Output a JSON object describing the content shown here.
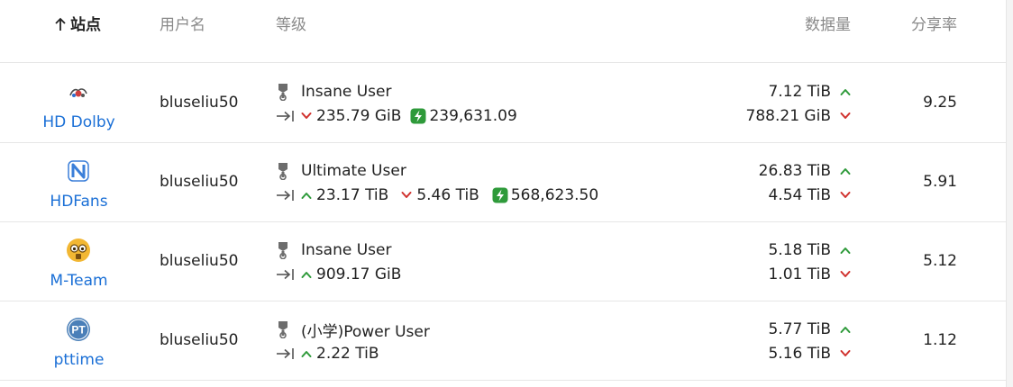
{
  "columns": {
    "site": "站点",
    "username": "用户名",
    "level": "等级",
    "data": "数据量",
    "ratio": "分享率"
  },
  "rows": [
    {
      "site": "HD Dolby",
      "logo_icon": "hd-dolby-logo-icon",
      "username": "bluseliu50",
      "level": "Insane User",
      "next_up": "",
      "next_down": "235.79 GiB",
      "bonus": "239,631.09",
      "uploaded": "7.12 TiB",
      "downloaded": "788.21 GiB",
      "ratio": "9.25"
    },
    {
      "site": "HDFans",
      "logo_icon": "hdfans-logo-icon",
      "username": "bluseliu50",
      "level": "Ultimate User",
      "next_up": "23.17 TiB",
      "next_down": "5.46 TiB",
      "bonus": "568,623.50",
      "uploaded": "26.83 TiB",
      "downloaded": "4.54 TiB",
      "ratio": "5.91"
    },
    {
      "site": "M-Team",
      "logo_icon": "m-team-logo-icon",
      "username": "bluseliu50",
      "level": "Insane User",
      "next_up": "909.17 GiB",
      "next_down": "",
      "bonus": "",
      "uploaded": "5.18 TiB",
      "downloaded": "1.01 TiB",
      "ratio": "5.12"
    },
    {
      "site": "pttime",
      "logo_icon": "pttime-logo-icon",
      "logo_text": "PT",
      "username": "bluseliu50",
      "level": "(小学)Power User",
      "next_up": "2.22 TiB",
      "next_down": "",
      "bonus": "",
      "uploaded": "5.77 TiB",
      "downloaded": "5.16 TiB",
      "ratio": "1.12"
    }
  ],
  "colors": {
    "link": "#1a6fd6",
    "up": "#2e9a3a",
    "down": "#d0312d",
    "bonus": "#2e9a3a",
    "muted": "#8a8a8a"
  }
}
